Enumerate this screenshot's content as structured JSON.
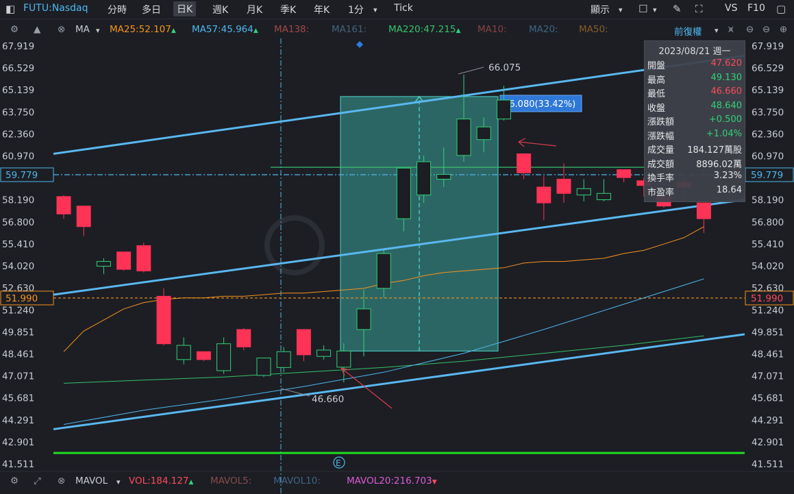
{
  "toolbar": {
    "symbol": "FUTU:Nasdaq",
    "tabs": [
      "分時",
      "多日",
      "日K",
      "週K",
      "月K",
      "季K",
      "年K",
      "1分",
      "Tick"
    ],
    "active_tab": "日K",
    "display_label": "顯示",
    "right_labels": [
      "VS",
      "F10"
    ]
  },
  "ma_bar": {
    "type_label": "MA",
    "items": [
      {
        "text": "MA25:52.107",
        "color": "#f7931e",
        "arrow": "▲"
      },
      {
        "text": "MA57:45.964",
        "color": "#4fb8ee",
        "arrow": "▲"
      },
      {
        "text": "MA138:",
        "color": "#a04848",
        "arrow": ""
      },
      {
        "text": "MA161:",
        "color": "#46627a",
        "arrow": ""
      },
      {
        "text": "MA220:47.215",
        "color": "#37c26a",
        "arrow": "▲"
      },
      {
        "text": "MA10:",
        "color": "#8a4242",
        "arrow": ""
      },
      {
        "text": "MA20:",
        "color": "#3f6585",
        "arrow": ""
      },
      {
        "text": "MA50:",
        "color": "#8a5c2a",
        "arrow": ""
      }
    ],
    "adjust_label": "前復權"
  },
  "info_panel": {
    "date": "2023/08/21 週一",
    "rows": [
      {
        "k": "開盤",
        "v": "47.620",
        "color": "#ff4a5e"
      },
      {
        "k": "最高",
        "v": "49.130",
        "color": "#33d17a"
      },
      {
        "k": "最低",
        "v": "46.660",
        "color": "#ff4a5e"
      },
      {
        "k": "收盤",
        "v": "48.640",
        "color": "#33d17a"
      },
      {
        "k": "漲跌額",
        "v": "+0.500",
        "color": "#33d17a"
      },
      {
        "k": "漲跌幅",
        "v": "+1.04%",
        "color": "#33d17a"
      },
      {
        "k": "成交量",
        "v": "184.127萬股",
        "color": "#e6e7ea"
      },
      {
        "k": "成交額",
        "v": "8896.02萬",
        "color": "#e6e7ea"
      },
      {
        "k": "換手率",
        "v": "3.23%",
        "color": "#e6e7ea"
      },
      {
        "k": "市盈率",
        "v": "18.64",
        "color": "#e6e7ea"
      }
    ]
  },
  "bottom_bar": {
    "type_label": "MAVOL",
    "items": [
      {
        "text": "VOL:184.127",
        "color": "#ff4a5e",
        "arrow": "▲"
      },
      {
        "text": "MAVOL5:",
        "color": "#8a4a4a",
        "arrow": ""
      },
      {
        "text": "MAVOL10:",
        "color": "#3f6585",
        "arrow": ""
      },
      {
        "text": "MAVOL20:216.703",
        "color": "#e05ad8",
        "arrow": "▼"
      }
    ]
  },
  "colors": {
    "up": "#33d17a",
    "down": "#ff3355",
    "bg": "#1c1e24",
    "trend": "#4fb8ee"
  },
  "chart_data": {
    "type": "candlestick",
    "ylim": [
      41.511,
      68.9
    ],
    "y_ticks": [
      "67.919",
      "66.529",
      "65.139",
      "63.750",
      "62.360",
      "60.970",
      "58.190",
      "56.800",
      "55.410",
      "54.020",
      "52.630",
      "51.240",
      "49.851",
      "48.461",
      "47.071",
      "45.681",
      "44.291",
      "42.901",
      "41.511"
    ],
    "candles": [
      {
        "o": 58.4,
        "h": 58.5,
        "l": 57.0,
        "c": 57.3
      },
      {
        "o": 57.8,
        "h": 57.8,
        "l": 55.9,
        "c": 56.5
      },
      {
        "o": 54.0,
        "h": 54.5,
        "l": 53.5,
        "c": 54.3
      },
      {
        "o": 54.9,
        "h": 54.9,
        "l": 53.7,
        "c": 53.8
      },
      {
        "o": 55.3,
        "h": 55.5,
        "l": 53.6,
        "c": 53.7
      },
      {
        "o": 52.1,
        "h": 52.6,
        "l": 49.0,
        "c": 49.1
      },
      {
        "o": 48.1,
        "h": 49.5,
        "l": 47.8,
        "c": 49.0
      },
      {
        "o": 48.6,
        "h": 48.6,
        "l": 48.0,
        "c": 48.1
      },
      {
        "o": 47.4,
        "h": 49.5,
        "l": 47.2,
        "c": 49.1
      },
      {
        "o": 50.0,
        "h": 50.1,
        "l": 48.7,
        "c": 48.9
      },
      {
        "o": 47.1,
        "h": 48.2,
        "l": 47.0,
        "c": 48.2
      },
      {
        "o": 47.6,
        "h": 48.9,
        "l": 47.3,
        "c": 48.6
      },
      {
        "o": 50.0,
        "h": 50.0,
        "l": 48.0,
        "c": 48.4
      },
      {
        "o": 48.3,
        "h": 49.0,
        "l": 48.1,
        "c": 48.7
      },
      {
        "o": 47.62,
        "h": 49.13,
        "l": 46.66,
        "c": 48.64
      },
      {
        "o": 50.0,
        "h": 52.5,
        "l": 48.3,
        "c": 51.3
      },
      {
        "o": 52.6,
        "h": 55.0,
        "l": 52.0,
        "c": 54.8
      },
      {
        "o": 57.0,
        "h": 60.0,
        "l": 56.2,
        "c": 60.2
      },
      {
        "o": 58.5,
        "h": 61.0,
        "l": 58.0,
        "c": 60.6
      },
      {
        "o": 59.5,
        "h": 61.5,
        "l": 59.0,
        "c": 59.8
      },
      {
        "o": 61.0,
        "h": 66.1,
        "l": 60.6,
        "c": 63.3
      },
      {
        "o": 62.0,
        "h": 63.4,
        "l": 61.2,
        "c": 62.8
      },
      {
        "o": 63.3,
        "h": 65.4,
        "l": 63.2,
        "c": 64.5
      },
      {
        "o": 61.1,
        "h": 61.1,
        "l": 59.5,
        "c": 59.9
      },
      {
        "o": 59.0,
        "h": 59.7,
        "l": 56.9,
        "c": 58.0
      },
      {
        "o": 59.5,
        "h": 60.5,
        "l": 58.0,
        "c": 58.6
      },
      {
        "o": 58.5,
        "h": 59.5,
        "l": 58.1,
        "c": 58.9
      },
      {
        "o": 58.2,
        "h": 59.5,
        "l": 58.1,
        "c": 58.6
      },
      {
        "o": 60.1,
        "h": 60.1,
        "l": 59.3,
        "c": 59.6
      },
      {
        "o": 59.4,
        "h": 59.6,
        "l": 58.4,
        "c": 59.1
      },
      {
        "o": 58.4,
        "h": 58.5,
        "l": 57.7,
        "c": 57.8
      },
      {
        "o": 59.3,
        "h": 59.5,
        "l": 58.5,
        "c": 59.0
      },
      {
        "o": 58.0,
        "h": 58.0,
        "l": 56.1,
        "c": 57.0
      }
    ],
    "ma25": [
      [
        1,
        48.6
      ],
      [
        2,
        49.9
      ],
      [
        3,
        50.6
      ],
      [
        4,
        51.3
      ],
      [
        5,
        51.7
      ],
      [
        6,
        51.9
      ],
      [
        7,
        52.0
      ],
      [
        8,
        52.0
      ],
      [
        9,
        52.1
      ],
      [
        10,
        52.1
      ],
      [
        11,
        52.2
      ],
      [
        12,
        52.3
      ],
      [
        13,
        52.3
      ],
      [
        14,
        52.4
      ],
      [
        15,
        52.5
      ],
      [
        16,
        52.6
      ],
      [
        17,
        52.9
      ],
      [
        18,
        53.1
      ],
      [
        19,
        53.4
      ],
      [
        20,
        53.6
      ],
      [
        21,
        53.7
      ],
      [
        22,
        53.8
      ],
      [
        23,
        53.9
      ],
      [
        24,
        54.2
      ],
      [
        25,
        54.3
      ],
      [
        26,
        54.3
      ],
      [
        27,
        54.4
      ],
      [
        28,
        54.5
      ],
      [
        29,
        54.8
      ],
      [
        30,
        55.0
      ],
      [
        31,
        55.4
      ],
      [
        32,
        55.8
      ],
      [
        33,
        56.5
      ]
    ],
    "ma57": [
      [
        1,
        44.0
      ],
      [
        5,
        44.9
      ],
      [
        9,
        45.6
      ],
      [
        13,
        46.4
      ],
      [
        17,
        47.3
      ],
      [
        21,
        48.5
      ],
      [
        25,
        50.0
      ],
      [
        29,
        51.6
      ],
      [
        33,
        53.2
      ]
    ],
    "ma220": [
      [
        1,
        46.6
      ],
      [
        5,
        46.8
      ],
      [
        9,
        47.0
      ],
      [
        13,
        47.3
      ],
      [
        17,
        47.6
      ],
      [
        21,
        48.0
      ],
      [
        25,
        48.5
      ],
      [
        29,
        49.0
      ],
      [
        33,
        49.6
      ]
    ],
    "trend_upper": [
      [
        0,
        61.1
      ],
      [
        33,
        67.3
      ]
    ],
    "trend_middle": [
      [
        0,
        52.2
      ],
      [
        33,
        58.2
      ]
    ],
    "trend_lower": [
      [
        0,
        43.7
      ],
      [
        33,
        49.7
      ]
    ],
    "h_lines": [
      {
        "value": 59.779,
        "color": "#4fb8ee",
        "label": "59.779"
      },
      {
        "value": 51.99,
        "color": "#f7931e",
        "label": "51.990"
      },
      {
        "value": 42.2,
        "color": "#22dd22",
        "label": ""
      },
      {
        "value": 60.25,
        "color": "#37c26a",
        "label": ""
      }
    ],
    "measure_box": {
      "from": 48.64,
      "to": 64.72,
      "label": "16.080(33.42%)"
    },
    "annotations": [
      "66.075",
      "46.660"
    ],
    "event_marker": "E"
  }
}
